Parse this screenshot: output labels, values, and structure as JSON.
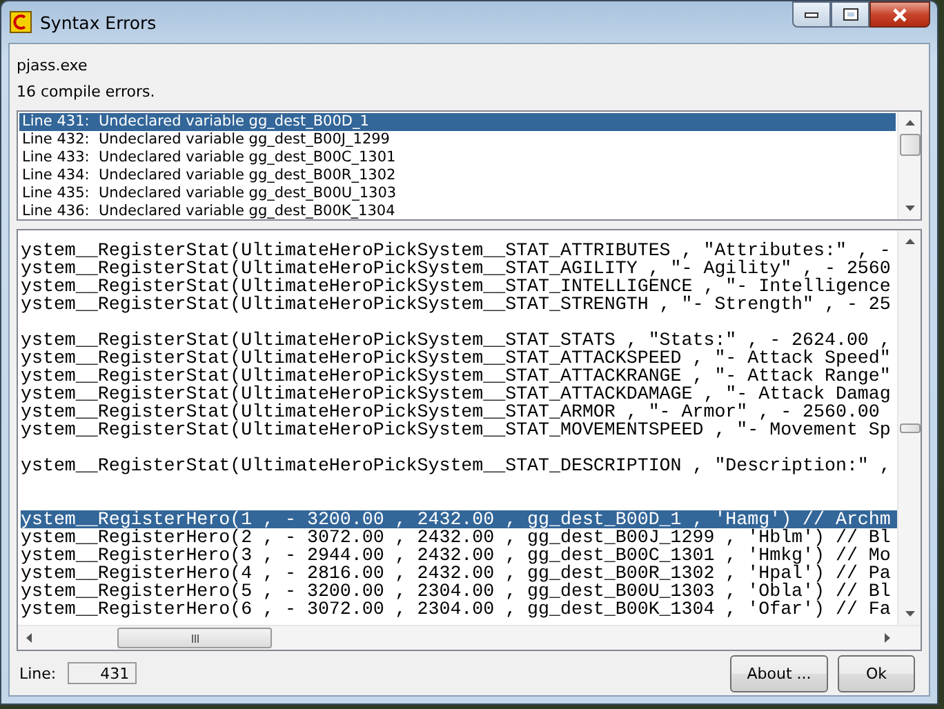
{
  "window": {
    "title": "Syntax Errors"
  },
  "program": "pjass.exe",
  "summary": "16 compile errors.",
  "errors": [
    {
      "text": "Line 431:  Undeclared variable gg_dest_B00D_1",
      "selected": true
    },
    {
      "text": "Line 432:  Undeclared variable gg_dest_B00J_1299",
      "selected": false
    },
    {
      "text": "Line 433:  Undeclared variable gg_dest_B00C_1301",
      "selected": false
    },
    {
      "text": "Line 434:  Undeclared variable gg_dest_B00R_1302",
      "selected": false
    },
    {
      "text": "Line 435:  Undeclared variable gg_dest_B00U_1303",
      "selected": false
    },
    {
      "text": "Line 436:  Undeclared variable gg_dest_B00K_1304",
      "selected": false
    }
  ],
  "code_lines": [
    {
      "kind": "code",
      "text": "ystem__RegisterStat(UltimateHeroPickSystem__STAT_ATTRIBUTES , \"Attributes:\" , -",
      "selected": false
    },
    {
      "kind": "code",
      "text": "ystem__RegisterStat(UltimateHeroPickSystem__STAT_AGILITY , \"- Agility\" , - 2560",
      "selected": false
    },
    {
      "kind": "code",
      "text": "ystem__RegisterStat(UltimateHeroPickSystem__STAT_INTELLIGENCE , \"- Intelligence",
      "selected": false
    },
    {
      "kind": "code",
      "text": "ystem__RegisterStat(UltimateHeroPickSystem__STAT_STRENGTH , \"- Strength\" , - 25",
      "selected": false
    },
    {
      "kind": "blank"
    },
    {
      "kind": "code",
      "text": "ystem__RegisterStat(UltimateHeroPickSystem__STAT_STATS , \"Stats:\" , - 2624.00 ,",
      "selected": false
    },
    {
      "kind": "code",
      "text": "ystem__RegisterStat(UltimateHeroPickSystem__STAT_ATTACKSPEED , \"- Attack Speed\"",
      "selected": false
    },
    {
      "kind": "code",
      "text": "ystem__RegisterStat(UltimateHeroPickSystem__STAT_ATTACKRANGE , \"- Attack Range\"",
      "selected": false
    },
    {
      "kind": "code",
      "text": "ystem__RegisterStat(UltimateHeroPickSystem__STAT_ATTACKDAMAGE , \"- Attack Damag",
      "selected": false
    },
    {
      "kind": "code",
      "text": "ystem__RegisterStat(UltimateHeroPickSystem__STAT_ARMOR , \"- Armor\" , - 2560.00",
      "selected": false
    },
    {
      "kind": "code",
      "text": "ystem__RegisterStat(UltimateHeroPickSystem__STAT_MOVEMENTSPEED , \"- Movement Sp",
      "selected": false
    },
    {
      "kind": "blank"
    },
    {
      "kind": "code",
      "text": "ystem__RegisterStat(UltimateHeroPickSystem__STAT_DESCRIPTION , \"Description:\" ,",
      "selected": false
    },
    {
      "kind": "blank"
    },
    {
      "kind": "blank"
    },
    {
      "kind": "code",
      "text": "ystem__RegisterHero(1 , - 3200.00 , 2432.00 , gg_dest_B00D_1 , 'Hamg') // Archm",
      "selected": true
    },
    {
      "kind": "code",
      "text": "ystem__RegisterHero(2 , - 3072.00 , 2432.00 , gg_dest_B00J_1299 , 'Hblm') // Bl",
      "selected": false
    },
    {
      "kind": "code",
      "text": "ystem__RegisterHero(3 , - 2944.00 , 2432.00 , gg_dest_B00C_1301 , 'Hmkg') // Mo",
      "selected": false
    },
    {
      "kind": "code",
      "text": "ystem__RegisterHero(4 , - 2816.00 , 2432.00 , gg_dest_B00R_1302 , 'Hpal') // Pa",
      "selected": false
    },
    {
      "kind": "code",
      "text": "ystem__RegisterHero(5 , - 3200.00 , 2304.00 , gg_dest_B00U_1303 , 'Obla') // Bl",
      "selected": false
    },
    {
      "kind": "code",
      "text": "ystem__RegisterHero(6 , - 3072.00 , 2304.00 , gg_dest_B00K_1304 , 'Ofar') // Fa",
      "selected": false
    }
  ],
  "line_field": {
    "label": "Line:",
    "value": "431"
  },
  "buttons": [
    "About ...",
    "Ok"
  ]
}
